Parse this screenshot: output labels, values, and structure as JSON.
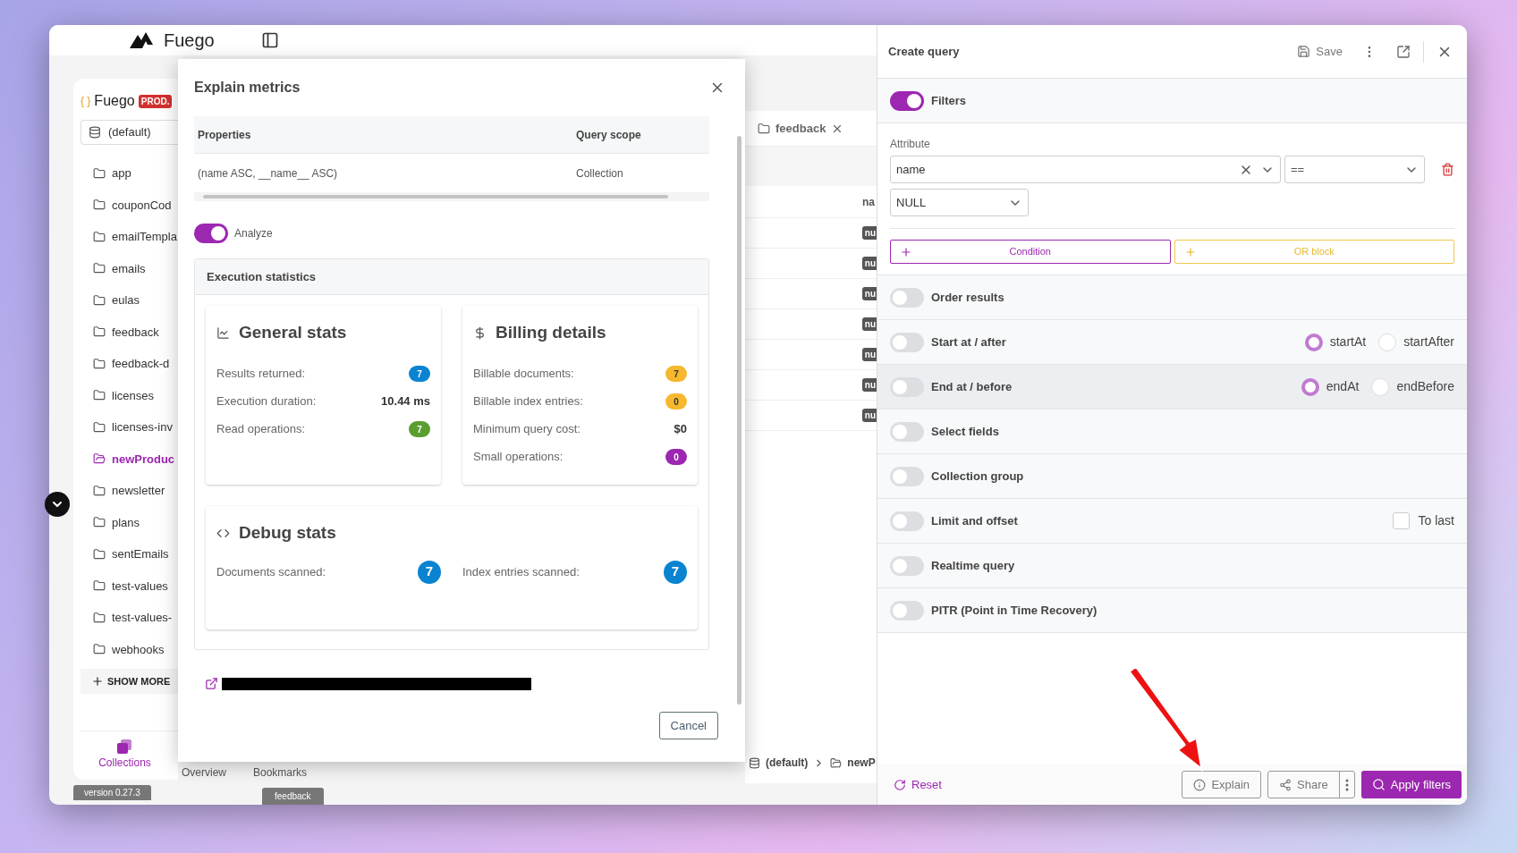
{
  "app": {
    "name": "Fuego"
  },
  "sidebar": {
    "project_icon": "{ }",
    "project": "Fuego",
    "badge": "PROD.",
    "database": "(default)",
    "collections": [
      {
        "label": "app",
        "selected": false
      },
      {
        "label": "couponCod",
        "selected": false
      },
      {
        "label": "emailTempla",
        "selected": false
      },
      {
        "label": "emails",
        "selected": false
      },
      {
        "label": "eulas",
        "selected": false
      },
      {
        "label": "feedback",
        "selected": false
      },
      {
        "label": "feedback-d",
        "selected": false
      },
      {
        "label": "licenses",
        "selected": false
      },
      {
        "label": "licenses-inv",
        "selected": false
      },
      {
        "label": "newProduc",
        "selected": true
      },
      {
        "label": "newsletter",
        "selected": false
      },
      {
        "label": "plans",
        "selected": false
      },
      {
        "label": "sentEmails",
        "selected": false
      },
      {
        "label": "test-values",
        "selected": false
      },
      {
        "label": "test-values-",
        "selected": false
      },
      {
        "label": "webhooks",
        "selected": false
      }
    ],
    "show_more": "SHOW MORE",
    "nav": [
      {
        "label": "Collections",
        "selected": true
      },
      {
        "label": "Overview",
        "selected": false
      },
      {
        "label": "Bookmarks",
        "selected": false
      }
    ],
    "version": "version 0.27.3",
    "feedback": "feedback"
  },
  "background": {
    "tab": "feedback",
    "column": "na",
    "badges": [
      "nu",
      "nu",
      "nu",
      "nu",
      "nu",
      "nu",
      "nu"
    ],
    "breadcrumb": [
      "(default)",
      "newP"
    ]
  },
  "dialog": {
    "title": "Explain metrics",
    "table": {
      "columns": [
        "Properties",
        "Query scope"
      ],
      "rows": [
        [
          "(name ASC, __name__ ASC)",
          "Collection"
        ]
      ]
    },
    "analyze": {
      "label": "Analyze",
      "on": true
    },
    "section": "Execution statistics",
    "cards": [
      {
        "title": "General stats",
        "rows": [
          {
            "label": "Results returned:",
            "value": "7",
            "color": "#0a84d0"
          },
          {
            "label": "Execution duration:",
            "value": "10.44 ms"
          },
          {
            "label": "Read operations:",
            "value": "7",
            "color": "#5a9e2f"
          }
        ]
      },
      {
        "title": "Billing details",
        "rows": [
          {
            "label": "Billable documents:",
            "value": "7",
            "color": "#f5b82e"
          },
          {
            "label": "Billable index entries:",
            "value": "0",
            "color": "#f5b82e"
          },
          {
            "label": "Minimum query cost:",
            "value": "$0"
          },
          {
            "label": "Small operations:",
            "value": "0",
            "color": "#9c27b0"
          }
        ]
      }
    ],
    "debug": {
      "title": "Debug stats",
      "rows": [
        {
          "label": "Documents scanned:",
          "value": "7",
          "color": "#0a84d0"
        },
        {
          "label": "Index entries scanned:",
          "value": "7",
          "color": "#0a84d0"
        }
      ]
    },
    "cancel": "Cancel"
  },
  "query_panel": {
    "title": "Create query",
    "save": "Save",
    "filters": {
      "label": "Filters",
      "on": true
    },
    "attribute_label": "Attribute",
    "attribute": "name",
    "operator": "==",
    "value": "NULL",
    "condition": "Condition",
    "or_block": "OR block",
    "options": [
      {
        "kind": "plain",
        "label": "Order results",
        "on": false,
        "hovered": false
      },
      {
        "kind": "radio",
        "label": "Start at / after",
        "on": false,
        "hovered": false,
        "choices": [
          {
            "label": "startAt",
            "selected": true
          },
          {
            "label": "startAfter",
            "selected": false
          }
        ]
      },
      {
        "kind": "radio",
        "label": "End at / before",
        "on": false,
        "hovered": true,
        "choices": [
          {
            "label": "endAt",
            "selected": true
          },
          {
            "label": "endBefore",
            "selected": false
          }
        ]
      },
      {
        "kind": "plain",
        "label": "Select fields",
        "on": false,
        "hovered": false
      },
      {
        "kind": "plain",
        "label": "Collection group",
        "on": false,
        "hovered": false
      },
      {
        "kind": "checkbox",
        "label": "Limit and offset",
        "on": false,
        "hovered": false,
        "check": {
          "label": "To last",
          "checked": false
        }
      },
      {
        "kind": "plain",
        "label": "Realtime query",
        "on": false,
        "hovered": false
      },
      {
        "kind": "plain",
        "label": "PITR (Point in Time Recovery)",
        "on": false,
        "hovered": false
      }
    ],
    "reset": "Reset",
    "explain": "Explain",
    "share": "Share",
    "apply": "Apply filters"
  }
}
